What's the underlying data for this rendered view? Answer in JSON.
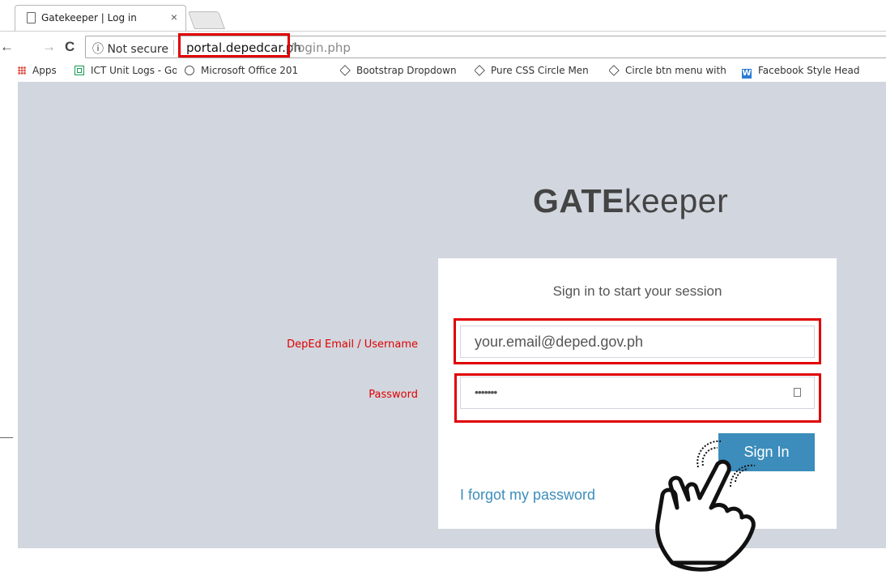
{
  "browser": {
    "tab_title": "Gatekeeper | Log in",
    "tab_close": "×",
    "security_label": "ⓘ Not secure",
    "url_domain": "portal.depedcar.ph",
    "url_path": "/login.php",
    "nav": {
      "back": "←",
      "forward": "→",
      "reload": "C"
    }
  },
  "bookmarks": [
    {
      "label": "Apps",
      "icon": "apps-grid-icon"
    },
    {
      "label": "ICT Unit Logs - Goog",
      "icon": "sheets-icon"
    },
    {
      "label": "Microsoft Office 201",
      "icon": "office-icon"
    },
    {
      "label": "Bootstrap Dropdown",
      "icon": "codepen-icon"
    },
    {
      "label": "Pure CSS Circle Men",
      "icon": "codepen-icon"
    },
    {
      "label": "Circle btn menu with",
      "icon": "codepen-icon"
    },
    {
      "label": "Facebook Style Head",
      "icon": "w-icon"
    }
  ],
  "page": {
    "logo_bold": "GATE",
    "logo_light": "keeper",
    "login_msg": "Sign in to start your session",
    "email_value": "your.email@deped.gov.ph",
    "password_value": "•••••••",
    "signin_label": "Sign In",
    "forgot_label": "I forgot my password"
  },
  "annotations": {
    "email_label": "DepEd Email / Username",
    "password_label": "Password"
  },
  "colors": {
    "viewport_bg": "#d2d6de",
    "primary": "#3c8dbc",
    "annotation_red": "#e00000"
  }
}
